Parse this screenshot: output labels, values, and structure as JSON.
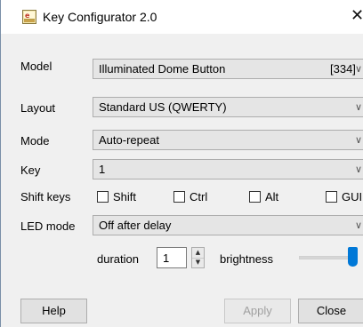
{
  "window": {
    "title": "Key Configurator 2.0",
    "icon": "key-configurator-app-icon",
    "icon_glyph": "ᵍ6",
    "close_glyph": "✕"
  },
  "form": {
    "model": {
      "label": "Model",
      "value": "Illuminated Dome Button",
      "extra": "[334]"
    },
    "layout": {
      "label": "Layout",
      "value": "Standard US (QWERTY)"
    },
    "mode": {
      "label": "Mode",
      "value": "Auto-repeat"
    },
    "key": {
      "label": "Key",
      "value": "1"
    },
    "shift_keys": {
      "label": "Shift keys",
      "options": [
        {
          "label": "Shift",
          "checked": false
        },
        {
          "label": "Ctrl",
          "checked": false
        },
        {
          "label": "Alt",
          "checked": false
        },
        {
          "label": "GUI",
          "checked": false
        }
      ]
    },
    "led_mode": {
      "label": "LED mode",
      "value": "Off after delay"
    },
    "duration": {
      "label": "duration",
      "value": "1"
    },
    "brightness": {
      "label": "brightness",
      "level": 1.0
    }
  },
  "dropdown_arrow": "∨",
  "spin_up_glyph": "▲",
  "spin_down_glyph": "▼",
  "buttons": {
    "help": "Help",
    "apply": "Apply",
    "close": "Close"
  },
  "colors": {
    "accent": "#0078d7",
    "window_bg": "#f0f0f0",
    "disabled_text": "#a0a0a0"
  }
}
